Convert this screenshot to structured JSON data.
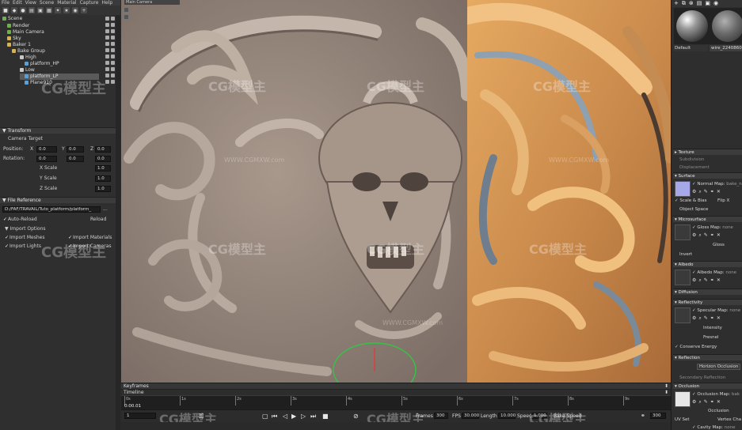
{
  "menu": [
    "File",
    "Edit",
    "View",
    "Scene",
    "Material",
    "Capture",
    "Help"
  ],
  "left_toolbar_icons": [
    "cube-icon",
    "light-icon",
    "sphere-icon",
    "folder-icon",
    "camera-icon",
    "group-icon",
    "light-bulb-icon",
    "star-icon",
    "bake-icon",
    "plus-icon"
  ],
  "scene_tree": [
    {
      "label": "Scene",
      "color": "#6fb04a"
    },
    {
      "label": "Render",
      "color": "#6fb04a"
    },
    {
      "label": "Main Camera",
      "color": "#6fb04a"
    },
    {
      "label": "Sky",
      "color": "#d8b24a"
    },
    {
      "label": "Baker 1",
      "color": "#d8b24a"
    },
    {
      "label": "Bake Group",
      "color": "#d8b24a"
    },
    {
      "label": "High",
      "color": "#c8c8c8"
    },
    {
      "label": "platform_HP",
      "color": "#5aa0d8"
    },
    {
      "label": "Low",
      "color": "#c8c8c8"
    },
    {
      "label": "platform_LP",
      "color": "#5aa0d8"
    },
    {
      "label": "Plane910",
      "color": "#5aa0d8"
    }
  ],
  "transform": {
    "header": "Transform",
    "target_label": "Camera Target",
    "position_label": "Position:",
    "rotation_label": "Rotation:",
    "x": "X",
    "y": "Y",
    "z": "Z",
    "pos_x": "0.0",
    "pos_y": "0.0",
    "pos_z": "0.0",
    "rot_x": "0.0",
    "rot_y": "0.0",
    "rot_z": "0.0",
    "x_scale_label": "X Scale",
    "y_scale_label": "Y Scale",
    "z_scale_label": "Z Scale",
    "x_scale": "1.0",
    "y_scale": "1.0",
    "z_scale": "1.0"
  },
  "file_reference": {
    "header": "File Reference",
    "path": "D:/FAF/TRAVAIL/Tuto_platform/platform_",
    "browse": "...",
    "auto_reload": "Auto-Reload",
    "reload": "Reload",
    "import_options": "Import Options",
    "import_meshes": "Import Meshes",
    "import_materials": "Import Materials",
    "import_lights": "Import Lights",
    "import_cameras": "Import Cameras"
  },
  "viewport": {
    "tab": "Main Camera",
    "watermark": "CG模型主",
    "watermark_url": "WWW.CGMXW.com"
  },
  "timeline": {
    "keyframes_label": "Keyframes",
    "timeline_label": "Timeline",
    "ruler_labels": [
      "0s",
      "1s",
      "2s",
      "3s",
      "4s",
      "5s",
      "6s",
      "7s",
      "8s",
      "9s"
    ],
    "current_time": "0:00.01",
    "current_frame": "1",
    "frames_label": "Frames",
    "frames_value": "300",
    "fps_label": "FPS",
    "fps_value": "30.000",
    "length_label": "Length",
    "length_value": "10.000",
    "speed_label": "Speed",
    "speed_value": "1.000",
    "bake_speed": "Bake Speed",
    "end_frame": "300"
  },
  "material": {
    "toolbar_icons": [
      "plus-icon",
      "duplicate-icon",
      "delete-icon",
      "folder-icon",
      "save-icon",
      "material-icon"
    ],
    "default_label": "Default",
    "mat2_label": "wire_224086086",
    "sections": {
      "texture": "Texture",
      "subdivision": "Subdivision",
      "displacement": "Displacement",
      "surface": "Surface",
      "normal_map": "Normal Map:",
      "normal_file": "bake_n",
      "scale_bias": "Scale & Bias",
      "flip_x": "Flip X",
      "object_space": "Object Space",
      "microsurface": "Microsurface",
      "gloss_map": "Gloss Map:",
      "gloss_file": "none",
      "gloss": "Gloss",
      "invert": "Invert",
      "albedo": "Albedo",
      "albedo_map": "Albedo Map:",
      "albedo_file": "none",
      "diffusion": "Diffusion",
      "reflectivity": "Reflectivity",
      "specular_map": "Specular Map:",
      "specular_file": "none",
      "intensity": "Intensity",
      "fresnel": "Fresnel",
      "conserve_energy": "Conserve Energy",
      "reflection": "Reflection",
      "horizon_occlusion": "Horizon Occlusion",
      "secondary_reflection": "Secondary Reflection",
      "occlusion": "Occlusion",
      "occlusion_map": "Occlusion Map:",
      "occlusion_file": "bak",
      "occlusion_btn": "Occlusion",
      "uv_set": "UV Set",
      "vertex_channel": "Vertex Cha",
      "cavity_map": "Cavity Map:",
      "cavity_file": "none"
    }
  },
  "colors": {
    "accent": "#4a86c8",
    "orange_material": "#d99a52",
    "clay_material": "#9a8b80"
  }
}
